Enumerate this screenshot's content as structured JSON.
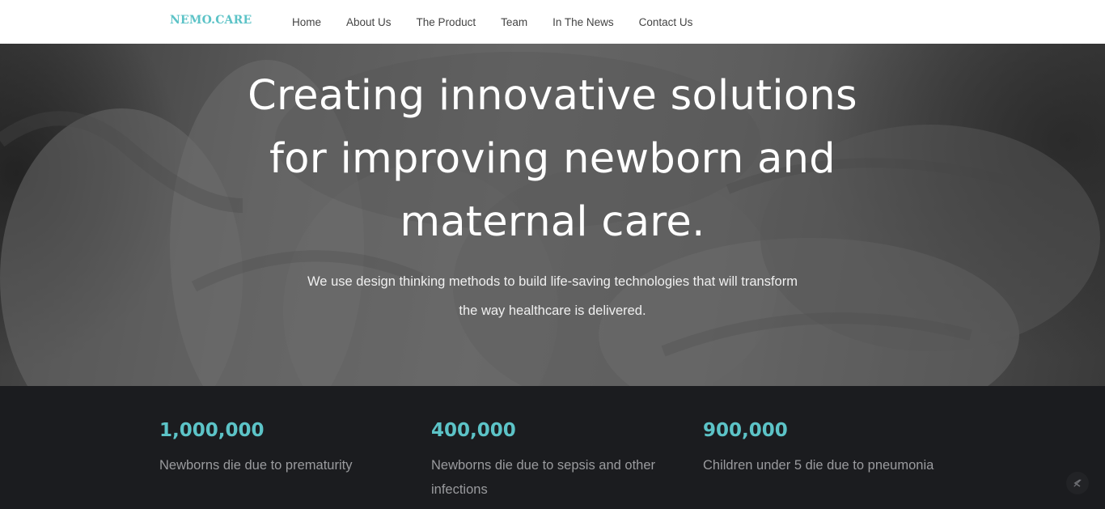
{
  "brand": {
    "name": "NEMO.CARE"
  },
  "nav": {
    "items": [
      "Home",
      "About Us",
      "The Product",
      "Team",
      "In The News",
      "Contact Us"
    ]
  },
  "hero": {
    "title_lines": [
      "Creating innovative solutions",
      "for improving newborn and",
      "maternal care."
    ],
    "subtitle_lines": [
      "We use design thinking methods to build life-saving technologies that will transform",
      "the way healthcare is delivered."
    ]
  },
  "stats": [
    {
      "number": "1,000,000",
      "description": "Newborns die due to prematurity"
    },
    {
      "number": "400,000",
      "description": "Newborns die due to sepsis and other infections"
    },
    {
      "number": "900,000",
      "description": "Children under 5 die due to pneumonia"
    }
  ],
  "icons": {
    "scroll_top": "back-to-top-icon"
  },
  "colors": {
    "accent": "#5cc3c7",
    "dark_bg": "#1b1c1f",
    "header_bg": "#ffffff"
  }
}
